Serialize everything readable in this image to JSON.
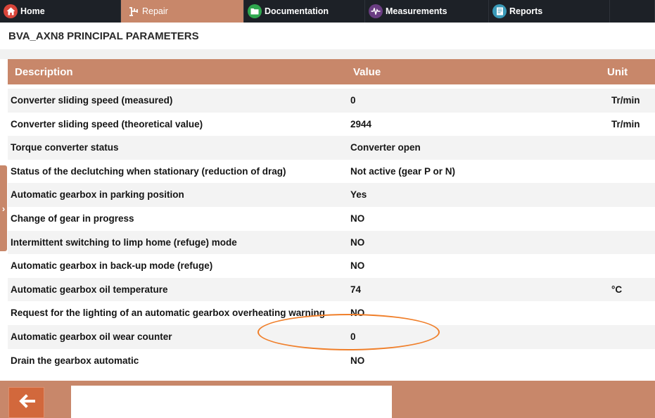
{
  "nav": {
    "tabs": [
      {
        "label": "Home",
        "icon": "home-icon",
        "active": false
      },
      {
        "label": "Repair",
        "icon": "repair-icon",
        "active": true
      },
      {
        "label": "Documentation",
        "icon": "folder-icon",
        "active": false
      },
      {
        "label": "Measurements",
        "icon": "waveform-icon",
        "active": false
      },
      {
        "label": "Reports",
        "icon": "report-icon",
        "active": false
      }
    ]
  },
  "page": {
    "title": "BVA_AXN8 PRINCIPAL PARAMETERS"
  },
  "table": {
    "headers": {
      "description": "Description",
      "value": "Value",
      "unit": "Unit"
    },
    "rows": [
      {
        "description": "Converter sliding speed (measured)",
        "value": "0",
        "unit": "Tr/min"
      },
      {
        "description": "Converter sliding speed (theoretical value)",
        "value": "2944",
        "unit": "Tr/min"
      },
      {
        "description": "Torque converter status",
        "value": "Converter open",
        "unit": ""
      },
      {
        "description": "Status of the declutching when stationary (reduction of drag)",
        "value": "Not active (gear P or N)",
        "unit": ""
      },
      {
        "description": "Automatic gearbox in parking position",
        "value": "Yes",
        "unit": ""
      },
      {
        "description": "Change of gear in progress",
        "value": "NO",
        "unit": ""
      },
      {
        "description": "Intermittent switching to limp home (refuge) mode",
        "value": "NO",
        "unit": ""
      },
      {
        "description": "Automatic gearbox in back-up mode (refuge)",
        "value": "NO",
        "unit": ""
      },
      {
        "description": "Automatic gearbox oil temperature",
        "value": "74",
        "unit": "°C"
      },
      {
        "description": "Request for the lighting of an automatic gearbox overheating warning",
        "value": "NO",
        "unit": ""
      },
      {
        "description": "Automatic gearbox oil wear counter",
        "value": "0",
        "unit": ""
      },
      {
        "description": "Drain the gearbox automatic",
        "value": "NO",
        "unit": ""
      }
    ]
  },
  "colors": {
    "accent": "#c8876a",
    "nav_bg": "#1d2127",
    "annotation": "#f07f2a",
    "back_button": "#d2683c"
  },
  "footer": {
    "back_icon": "arrow-left-icon"
  }
}
